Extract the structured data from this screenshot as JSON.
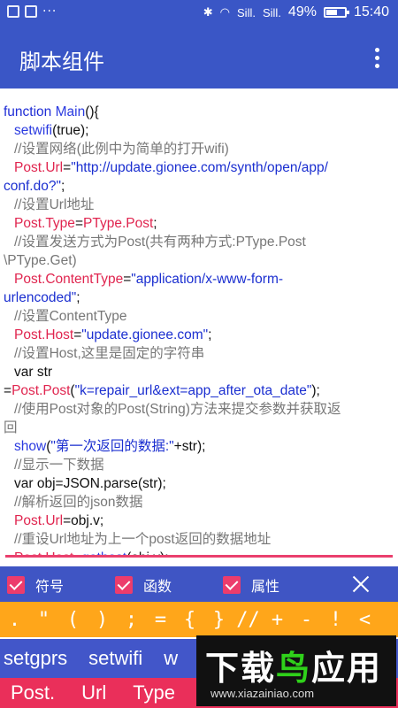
{
  "status_bar": {
    "signal1": "Sill.",
    "signal2": "Sill.",
    "battery_pct": "49%",
    "time": "15:40"
  },
  "app_bar": {
    "title": "脚本组件"
  },
  "code": [
    [
      {
        "t": "function ",
        "c": "kw"
      },
      {
        "t": "Main",
        "c": "fn"
      },
      {
        "t": "(){",
        "c": "plain"
      }
    ],
    [
      {
        "t": "setwifi",
        "c": "fn",
        "i": 1
      },
      {
        "t": "(true);",
        "c": "plain"
      }
    ],
    [
      {
        "t": "//设置网络(此例中为简单的打开wifi)",
        "c": "cmt",
        "i": 1
      }
    ],
    [
      {
        "t": "Post.Url",
        "c": "prop",
        "i": 1
      },
      {
        "t": "=",
        "c": "plain"
      },
      {
        "t": "\"http://update.gionee.com/synth/open/app/",
        "c": "str"
      }
    ],
    [
      {
        "t": "conf.do?\"",
        "c": "str"
      },
      {
        "t": ";",
        "c": "plain"
      }
    ],
    [
      {
        "t": "//设置Url地址",
        "c": "cmt",
        "i": 1
      }
    ],
    [
      {
        "t": "Post.Type",
        "c": "prop",
        "i": 1
      },
      {
        "t": "=",
        "c": "plain"
      },
      {
        "t": "PType.Post",
        "c": "prop"
      },
      {
        "t": ";",
        "c": "plain"
      }
    ],
    [
      {
        "t": "//设置发送方式为Post(共有两种方式:PType.Post",
        "c": "cmt",
        "i": 1
      }
    ],
    [
      {
        "t": "\\PType.Get)",
        "c": "cmt"
      }
    ],
    [
      {
        "t": "Post.ContentType",
        "c": "prop",
        "i": 1
      },
      {
        "t": "=",
        "c": "plain"
      },
      {
        "t": "\"application/x-www-form-",
        "c": "str"
      }
    ],
    [
      {
        "t": "urlencoded\"",
        "c": "str"
      },
      {
        "t": ";",
        "c": "plain"
      }
    ],
    [
      {
        "t": "//设置ContentType",
        "c": "cmt",
        "i": 1
      }
    ],
    [
      {
        "t": "Post.Host",
        "c": "prop",
        "i": 1
      },
      {
        "t": "=",
        "c": "plain"
      },
      {
        "t": "\"update.gionee.com\"",
        "c": "str"
      },
      {
        "t": ";",
        "c": "plain"
      }
    ],
    [
      {
        "t": "//设置Host,这里是固定的字符串",
        "c": "cmt",
        "i": 1
      }
    ],
    [
      {
        "t": "var ",
        "c": "plain",
        "i": 1
      },
      {
        "t": "str",
        "c": "plain"
      }
    ],
    [
      {
        "t": "=",
        "c": "plain"
      },
      {
        "t": "Post.Post",
        "c": "prop"
      },
      {
        "t": "(",
        "c": "plain"
      },
      {
        "t": "\"k=repair_url&ext=app_after_ota_date\"",
        "c": "str"
      },
      {
        "t": ");",
        "c": "plain"
      }
    ],
    [
      {
        "t": "//使用Post对象的Post(String)方法来提交参数并获取返",
        "c": "cmt",
        "i": 1
      }
    ],
    [
      {
        "t": "回",
        "c": "cmt"
      }
    ],
    [
      {
        "t": "show",
        "c": "fn",
        "i": 1
      },
      {
        "t": "(",
        "c": "plain"
      },
      {
        "t": "\"第一次返回的数据:\"",
        "c": "str"
      },
      {
        "t": "+str);",
        "c": "plain"
      }
    ],
    [
      {
        "t": "//显示一下数据",
        "c": "cmt",
        "i": 1
      }
    ],
    [
      {
        "t": "var ",
        "c": "plain",
        "i": 1
      },
      {
        "t": "obj=JSON.parse(str);",
        "c": "plain"
      }
    ],
    [
      {
        "t": "//解析返回的json数据",
        "c": "cmt",
        "i": 1
      }
    ],
    [
      {
        "t": "Post.Url",
        "c": "prop",
        "i": 1
      },
      {
        "t": "=obj.v;",
        "c": "plain"
      }
    ],
    [
      {
        "t": "//重设Url地址为上一个post返回的数据地址",
        "c": "cmt",
        "i": 1
      }
    ],
    [
      {
        "t": "Post.Host",
        "c": "prop",
        "i": 1
      },
      {
        "t": "=",
        "c": "plain"
      },
      {
        "t": "gethost",
        "c": "fn"
      },
      {
        "t": "(obj.v);",
        "c": "plain"
      }
    ]
  ],
  "checkboxes": [
    {
      "label": "符号",
      "checked": true
    },
    {
      "label": "函数",
      "checked": true
    },
    {
      "label": "属性",
      "checked": true
    }
  ],
  "symbols": [
    ".",
    "\"",
    "(",
    ")",
    ";",
    "=",
    "{",
    "}",
    "//",
    "+",
    "-",
    "!",
    "<"
  ],
  "functions": [
    "setgprs",
    "setwifi",
    "w"
  ],
  "properties": [
    "Post.",
    "Url",
    "Type"
  ],
  "watermark": {
    "brand_part1": "下载",
    "brand_part2": "鸟",
    "brand_part3": "应用",
    "url": "www.xiazainiao.com"
  },
  "colors": {
    "primary": "#3a56c6",
    "accent_pink": "#ea2f5a",
    "symbol_orange": "#ffa61a"
  }
}
